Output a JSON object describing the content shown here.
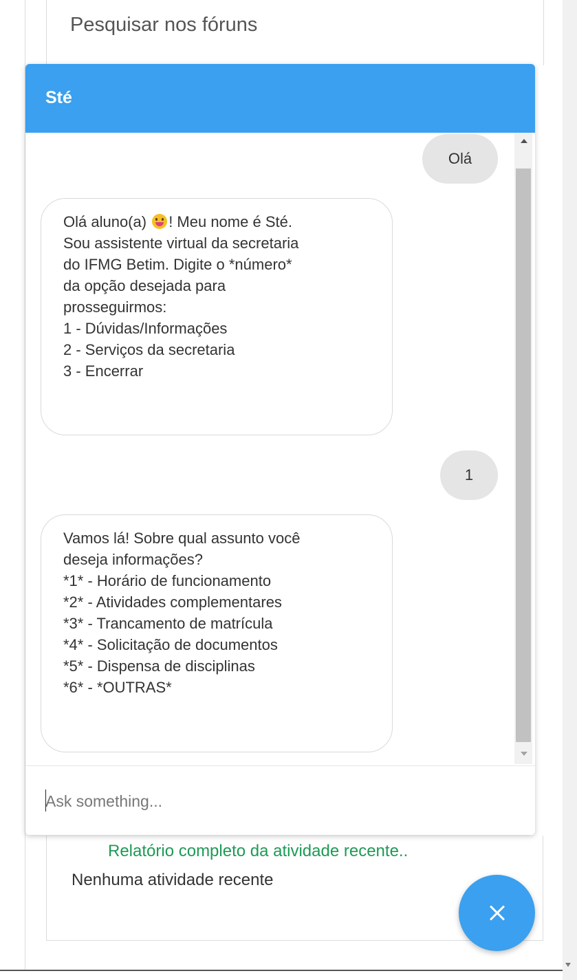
{
  "page": {
    "search_label": "Pesquisar nos fóruns",
    "report_link": "Relatório completo da atividade recente..",
    "no_activity": "Nenhuma atividade recente"
  },
  "chat": {
    "title": "Sté",
    "input_placeholder": "Ask something...",
    "messages": [
      {
        "from": "user",
        "text": "Olá"
      },
      {
        "from": "bot",
        "text_before_emoji": "Olá aluno(a) ",
        "emoji": "grinning-face-with-tongue-emoji",
        "text_after_emoji": "! Meu nome é Sté.\nSou assistente virtual da secretaria\ndo IFMG Betim. Digite o *número*\nda opção desejada para\nprosseguirmos:\n1 - Dúvidas/Informações\n2 - Serviços da secretaria\n3 - Encerrar"
      },
      {
        "from": "user",
        "text": "1"
      },
      {
        "from": "bot",
        "text": "Vamos lá! Sobre qual assunto você\ndeseja informações?\n*1* - Horário de funcionamento\n*2* - Atividades complementares\n*3* - Trancamento de matrícula\n*4* - Solicitação de documentos\n*5* - Dispensa de disciplinas\n*6* - *OUTRAS*"
      }
    ]
  },
  "colors": {
    "header": "#3aa0ef",
    "fab": "#3aa0ef",
    "link": "#1d9a55",
    "user_bubble": "#e5e5e5"
  },
  "icons": {
    "fab": "close-icon"
  }
}
